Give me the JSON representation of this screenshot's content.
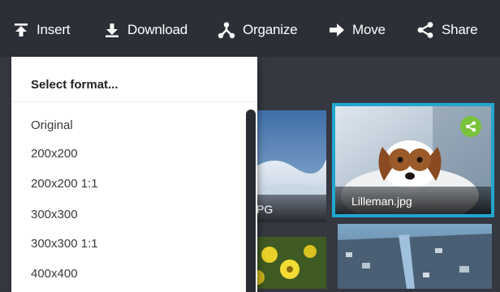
{
  "toolbar": {
    "insert_label": "Insert",
    "download_label": "Download",
    "organize_label": "Organize",
    "move_label": "Move",
    "share_label": "Share"
  },
  "format_menu": {
    "header": "Select format...",
    "options": [
      "Original",
      "200x200",
      "200x200 1:1",
      "300x300",
      "300x300 1:1",
      "400x400"
    ]
  },
  "thumbnails": [
    {
      "caption": "PG",
      "content": "snowy hills"
    },
    {
      "caption": "Lilleman.jpg",
      "content": "puppy",
      "selected": true,
      "shared": true
    },
    {
      "caption": "",
      "content": "yellow flowers"
    },
    {
      "caption": "",
      "content": "aerial city"
    }
  ],
  "icons": {
    "insert": "insert-icon",
    "download": "download-icon",
    "organize": "organize-icon",
    "move": "arrow-right-icon",
    "share": "share-icon"
  },
  "colors": {
    "toolbar_bg": "#2c2f37",
    "content_bg": "#353841",
    "selection_border": "#21a6cf",
    "share_badge": "#79c23c"
  }
}
